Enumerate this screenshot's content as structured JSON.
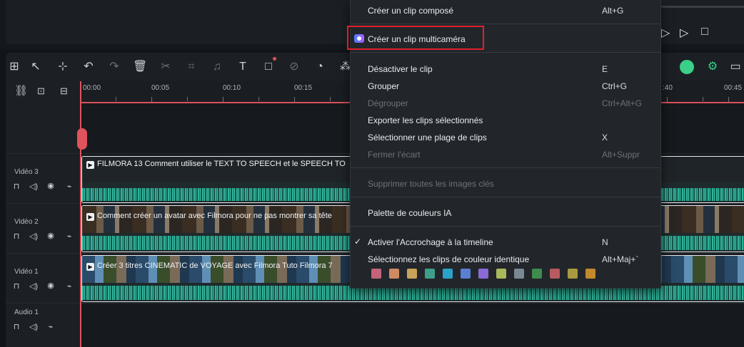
{
  "timeline": {
    "ruler": [
      "00:00",
      "00:05",
      "00:10",
      "00:15",
      ":40",
      "00:45"
    ],
    "tracks": [
      {
        "label": "Vidéo 3"
      },
      {
        "label": "Vidéo 2"
      },
      {
        "label": "Vidéo 1"
      },
      {
        "label": "Audio 1"
      }
    ],
    "clips": {
      "video3_title": "FILMORA 13  Comment utiliser le TEXT TO SPEECH et le SPEECH TO",
      "video2_title": "Comment créer un avatar avec Filmora pour ne pas montrer sa tête",
      "video1_title": "Créer 3 titres CINEMATIC de VOYAGE avec Filmora  Tuto Filmora  7"
    }
  },
  "menu": {
    "items": [
      {
        "label": "Créer un clip composé",
        "shortcut": "Alt+G",
        "disabled": false
      },
      {
        "label": "Créer un clip multicaméra",
        "shortcut": "",
        "disabled": false
      },
      {
        "label": "Désactiver le clip",
        "shortcut": "E",
        "disabled": false
      },
      {
        "label": "Grouper",
        "shortcut": "Ctrl+G",
        "disabled": false
      },
      {
        "label": "Dégrouper",
        "shortcut": "Ctrl+Alt+G",
        "disabled": true
      },
      {
        "label": "Exporter les clips sélectionnés",
        "shortcut": "",
        "disabled": false
      },
      {
        "label": "Sélectionner une plage de clips",
        "shortcut": "X",
        "disabled": false
      },
      {
        "label": "Fermer l'écart",
        "shortcut": "Alt+Suppr",
        "disabled": true
      },
      {
        "label": "Supprimer toutes les images clés",
        "shortcut": "",
        "disabled": true
      },
      {
        "label": "Palette de couleurs IA",
        "shortcut": "",
        "disabled": false
      },
      {
        "label": "Activer l'Accrochage à la timeline",
        "shortcut": "N",
        "disabled": false
      },
      {
        "label": "Sélectionnez les clips de couleur identique",
        "shortcut": "Alt+Maj+`",
        "disabled": false
      }
    ],
    "swatches": [
      "#c4647a",
      "#cf8a62",
      "#c9a25a",
      "#3f9e8a",
      "#2ba3c8",
      "#5b7fd1",
      "#8a6bd6",
      "#a8b85a",
      "#7a8893",
      "#3f8c4e",
      "#b85a60",
      "#a89a40",
      "#c4892e"
    ]
  },
  "colors": {
    "accent": "#e0535c",
    "highlight": "#e0202a",
    "waveform": "#2fb39a"
  }
}
